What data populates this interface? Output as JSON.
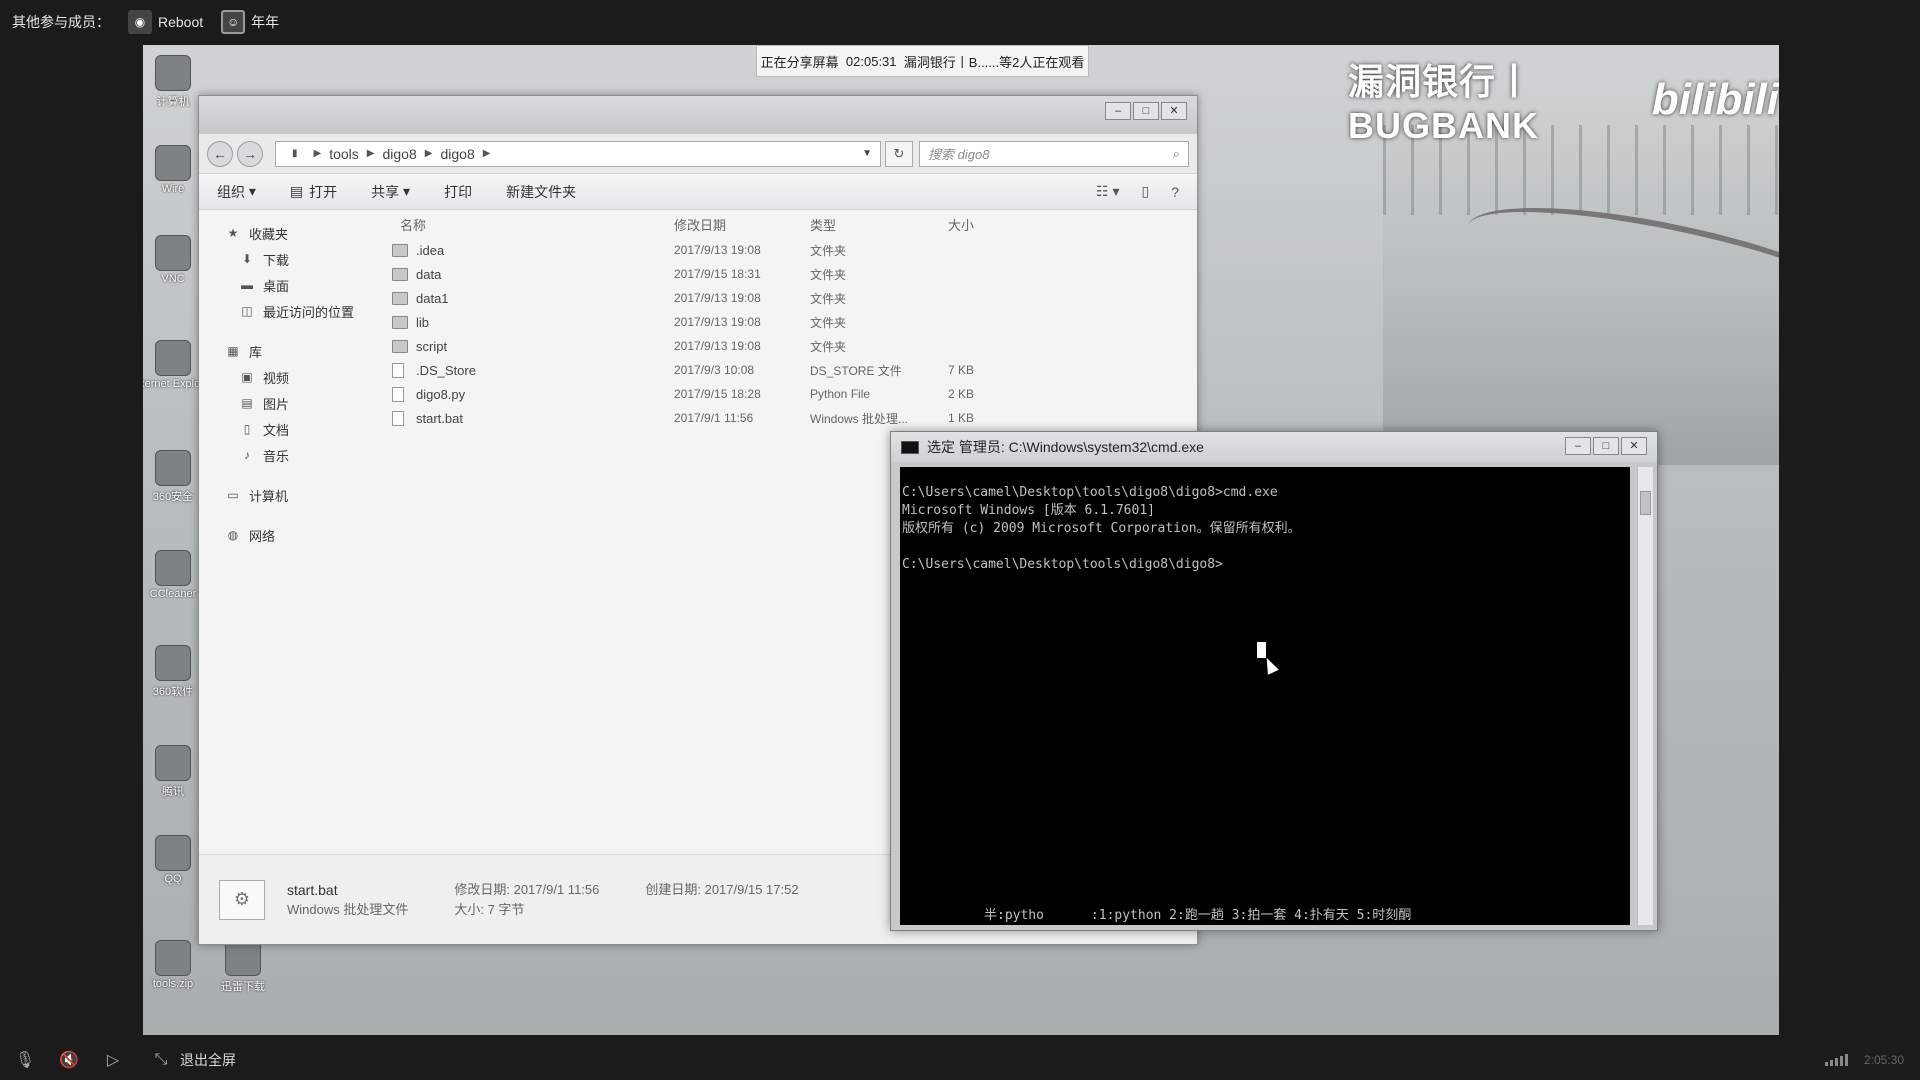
{
  "meeting": {
    "participants_label": "其他参与成员：",
    "participants": [
      {
        "name": "Reboot",
        "avatar_icon": "robot-avatar-icon"
      },
      {
        "name": "年年",
        "avatar_icon": "user-avatar-icon"
      }
    ],
    "share_indicator": {
      "status": "正在分享屏幕",
      "elapsed": "02:05:31",
      "viewers": "漏洞银行丨B......等2人正在观看"
    },
    "exit_fullscreen": "退出全屏",
    "clock": "2:05:30"
  },
  "brand": {
    "text": "漏洞银行丨BUGBANK",
    "logo": "bilibili"
  },
  "desktop_icons": [
    {
      "label": "计算机"
    },
    {
      "label": "Wire"
    },
    {
      "label": "VNC"
    },
    {
      "label": "Internet Explorer"
    },
    {
      "label": "360安全"
    },
    {
      "label": "CCleaner"
    },
    {
      "label": "360软件"
    },
    {
      "label": "腾讯"
    },
    {
      "label": "QQ"
    },
    {
      "label": "tools.zip"
    },
    {
      "label": "迅雷下载"
    }
  ],
  "explorer": {
    "breadcrumb": [
      "tools",
      "digo8",
      "digo8"
    ],
    "search_placeholder": "搜索 digo8",
    "toolbar": {
      "organize": "组织",
      "open": "打开",
      "share": "共享",
      "print": "打印",
      "new_folder": "新建文件夹"
    },
    "nav": {
      "favorites": "收藏夹",
      "downloads": "下载",
      "desktop": "桌面",
      "recent": "最近访问的位置",
      "libraries": "库",
      "videos": "视频",
      "pictures": "图片",
      "documents": "文档",
      "music": "音乐",
      "computer": "计算机",
      "network": "网络"
    },
    "columns": {
      "name": "名称",
      "date": "修改日期",
      "type": "类型",
      "size": "大小"
    },
    "files": [
      {
        "name": ".idea",
        "date": "2017/9/13 19:08",
        "type": "文件夹",
        "size": "",
        "kind": "folder"
      },
      {
        "name": "data",
        "date": "2017/9/15 18:31",
        "type": "文件夹",
        "size": "",
        "kind": "folder"
      },
      {
        "name": "data1",
        "date": "2017/9/13 19:08",
        "type": "文件夹",
        "size": "",
        "kind": "folder"
      },
      {
        "name": "lib",
        "date": "2017/9/13 19:08",
        "type": "文件夹",
        "size": "",
        "kind": "folder"
      },
      {
        "name": "script",
        "date": "2017/9/13 19:08",
        "type": "文件夹",
        "size": "",
        "kind": "folder"
      },
      {
        "name": ".DS_Store",
        "date": "2017/9/3 10:08",
        "type": "DS_STORE 文件",
        "size": "7 KB",
        "kind": "file"
      },
      {
        "name": "digo8.py",
        "date": "2017/9/15 18:28",
        "type": "Python File",
        "size": "2 KB",
        "kind": "file"
      },
      {
        "name": "start.bat",
        "date": "2017/9/1 11:56",
        "type": "Windows 批处理...",
        "size": "1 KB",
        "kind": "file"
      }
    ],
    "details": {
      "file_name": "start.bat",
      "file_type": "Windows 批处理文件",
      "modified": "修改日期: 2017/9/1 11:56",
      "size": "大小: 7 字节",
      "created": "创建日期: 2017/9/15 17:52"
    }
  },
  "cmd": {
    "title": "选定 管理员: C:\\Windows\\system32\\cmd.exe",
    "lines": [
      "C:\\Users\\camel\\Desktop\\tools\\digo8\\digo8>cmd.exe",
      "Microsoft Windows [版本 6.1.7601]",
      "版权所有 (c) 2009 Microsoft Corporation。保留所有权利。",
      "",
      "C:\\Users\\camel\\Desktop\\tools\\digo8\\digo8>"
    ],
    "ime_bar": "半:pytho      :1:python 2:跑一趟 3:拍一套 4:扑有天 5:时刻酮"
  }
}
